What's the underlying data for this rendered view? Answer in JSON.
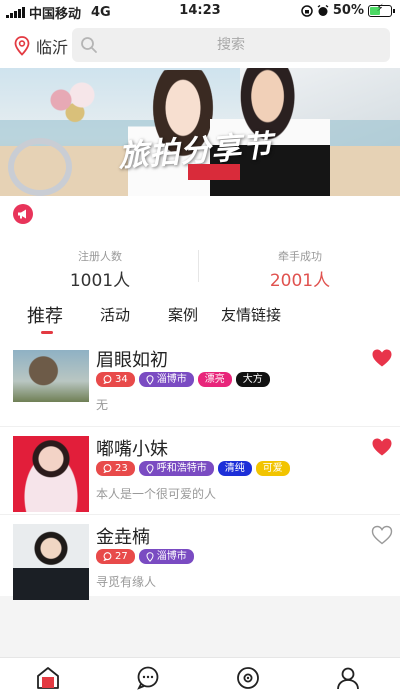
{
  "status_bar": {
    "carrier": "中国移动",
    "network": "4G",
    "time": "14:23",
    "battery_percent": "50%",
    "battery_level": 0.5
  },
  "header": {
    "city": "临沂",
    "search_placeholder": "搜索"
  },
  "banner": {
    "title": "旅拍分享节"
  },
  "stats": [
    {
      "label": "注册人数",
      "value": "1001人",
      "color": "#333333"
    },
    {
      "label": "牵手成功",
      "value": "2001人",
      "color": "#e0524f"
    }
  ],
  "tabs": [
    {
      "label": "推荐",
      "active": true
    },
    {
      "label": "活动",
      "active": false
    },
    {
      "label": "案例",
      "active": false
    },
    {
      "label": "友情链接",
      "active": false
    }
  ],
  "profiles": [
    {
      "name": "眉眼如初",
      "comments": "34",
      "city": "淄博市",
      "tags": [
        {
          "text": "漂亮",
          "color": "#e8257a"
        },
        {
          "text": "大方",
          "color": "#111111"
        }
      ],
      "bio": "无",
      "liked": true
    },
    {
      "name": "嘟嘴小妹",
      "comments": "23",
      "city": "呼和浩特市",
      "tags": [
        {
          "text": "清纯",
          "color": "#1d2fd8"
        },
        {
          "text": "可爱",
          "color": "#f2c400"
        }
      ],
      "bio": "本人是一个很可爱的人",
      "liked": true
    },
    {
      "name": "金垚楠",
      "comments": "27",
      "city": "淄博市",
      "tags": [],
      "bio": "寻觅有缘人",
      "liked": false
    }
  ],
  "colors": {
    "accent": "#e33a42",
    "comment_tag": "#e84a4a",
    "city_tag": "#7a4bc2",
    "heart": "#e8344a"
  },
  "bottom_nav": [
    {
      "icon": "home-icon",
      "active": true
    },
    {
      "icon": "message-icon",
      "active": false
    },
    {
      "icon": "discover-icon",
      "active": false
    },
    {
      "icon": "profile-icon",
      "active": false
    }
  ]
}
